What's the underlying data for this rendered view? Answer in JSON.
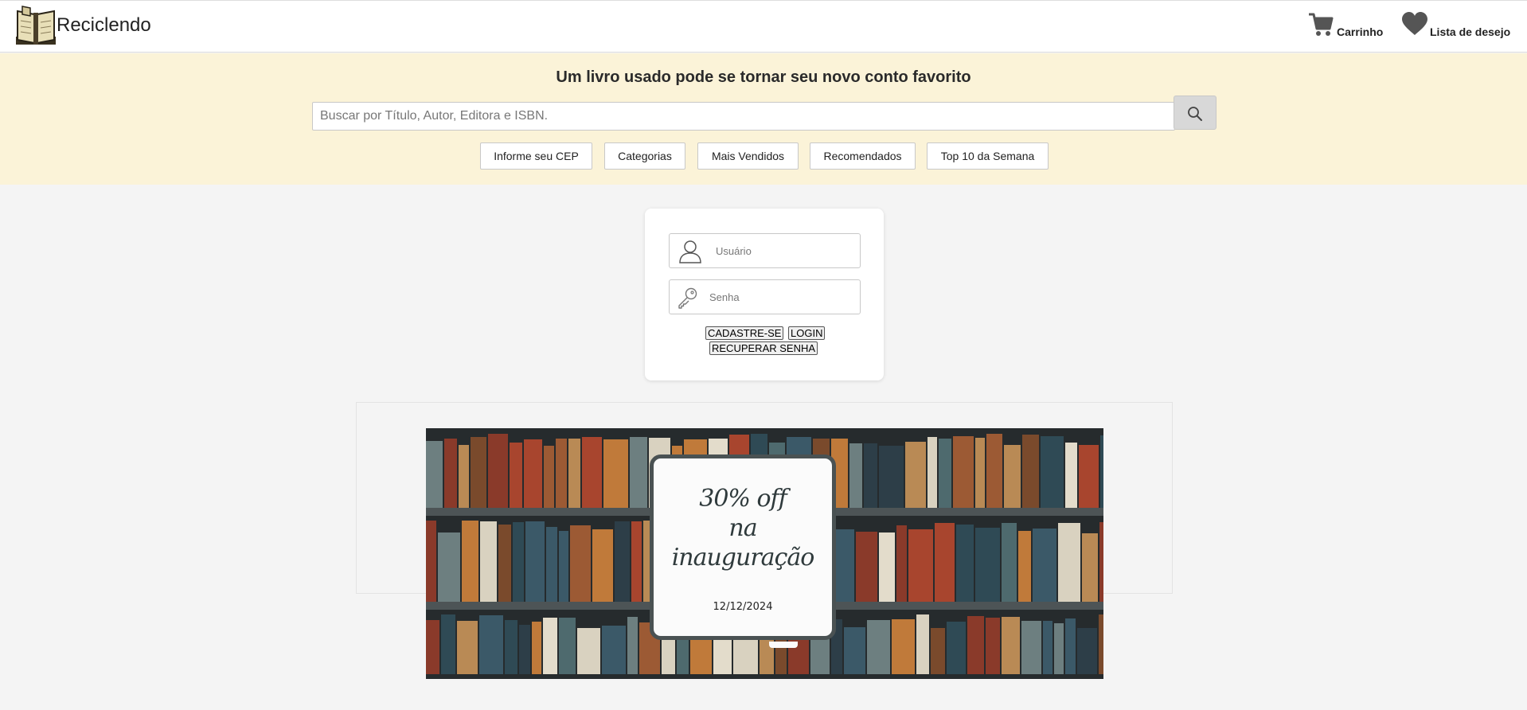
{
  "header": {
    "logo_text": "Reciclendo",
    "cart_label": "Carrinho",
    "wishlist_label": "Lista de desejo"
  },
  "banner": {
    "tagline": "Um livro usado pode se tornar seu novo conto favorito",
    "search_placeholder": "Buscar por Título, Autor, Editora e ISBN.",
    "nav_buttons": [
      "Informe seu CEP",
      "Categorias",
      "Mais Vendidos",
      "Recomendados",
      "Top 10 da Semana"
    ]
  },
  "login": {
    "user_placeholder": "Usuário",
    "password_placeholder": "Senha",
    "register_label": "CADASTRE-SE",
    "login_label": "LOGIN",
    "recover_label": "RECUPERAR SENHA"
  },
  "promo": {
    "line1": "30% off",
    "line2": "na",
    "line3": "inauguração",
    "date": "12/12/2024"
  },
  "colors": {
    "band": "#fbf3d8",
    "page_bg": "#f4f4f4",
    "icon_gray": "#555555"
  },
  "icons": [
    "book-logo-icon",
    "cart-icon",
    "heart-icon",
    "search-icon",
    "user-icon",
    "key-icon"
  ]
}
